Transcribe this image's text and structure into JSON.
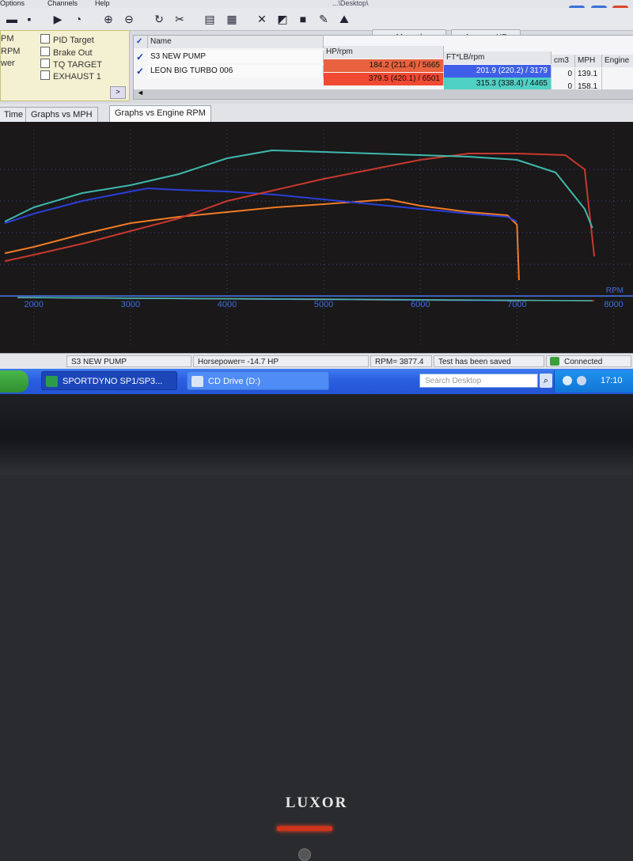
{
  "menu": {
    "items": [
      "Options",
      "Channels",
      "Help"
    ],
    "title_fragment": "...\\Desktop\\"
  },
  "toolbar": {
    "manual_label": "Manual",
    "average_hp_label": "Average HP"
  },
  "channels": [
    {
      "left_label": "PM",
      "right_label": "PID Target"
    },
    {
      "left_label": "RPM",
      "right_label": "Brake Out"
    },
    {
      "left_label": "wer",
      "right_label": "TQ TARGET"
    },
    {
      "left_label": "",
      "right_label": "EXHAUST 1"
    }
  ],
  "runs_table": {
    "columns": [
      "Name",
      "HP/rpm",
      "FT*LB/rpm",
      "cm3",
      "MPH",
      "Engine"
    ],
    "rows": [
      {
        "name": "S3 NEW PUMP",
        "hp": "184.2 (211.4) / 5665",
        "torque": "201.9 (220.2) / 3179",
        "cm3": "0",
        "mph": "139.1",
        "hp_color": "#e8623f",
        "tq_color": "#3f5fe8"
      },
      {
        "name": "LEON BIG TURBO 006",
        "hp": "379.5 (420.1) / 6501",
        "torque": "315.3 (338.4) / 4465",
        "cm3": "0",
        "mph": "158.1",
        "hp_color": "#f04a32",
        "tq_color": "#4fd0c4"
      }
    ]
  },
  "graph_tabs": [
    "Time",
    "Graphs vs MPH",
    "Graphs vs Engine RPM"
  ],
  "graph": {
    "x_axis_label": "RPM",
    "x_ticks": [
      "2000",
      "3000",
      "4000",
      "5000",
      "6000",
      "7000",
      "8000"
    ]
  },
  "chart_data": {
    "type": "line",
    "xlabel": "RPM",
    "xlim": [
      1650,
      8200
    ],
    "x_ticks": [
      2000,
      3000,
      4000,
      5000,
      6000,
      7000,
      8000
    ],
    "series": [
      {
        "name": "S3 NEW PUMP",
        "quantity": "HP",
        "color": "#f07b28",
        "x": [
          1700,
          2000,
          2500,
          3000,
          3500,
          4000,
          4500,
          5000,
          5665,
          6000,
          6500,
          6900,
          7000,
          7020
        ],
        "y": [
          0.27,
          0.31,
          0.39,
          0.46,
          0.5,
          0.53,
          0.56,
          0.58,
          0.61,
          0.57,
          0.53,
          0.51,
          0.45,
          0.1
        ]
      },
      {
        "name": "S3 NEW PUMP",
        "quantity": "TQ",
        "color": "#2b3fd6",
        "x": [
          1700,
          2000,
          2500,
          3000,
          3179,
          3500,
          4000,
          4500,
          5000,
          5500,
          6000,
          6500,
          6900,
          7000
        ],
        "y": [
          0.46,
          0.52,
          0.6,
          0.66,
          0.68,
          0.67,
          0.66,
          0.64,
          0.61,
          0.58,
          0.55,
          0.52,
          0.5,
          0.47
        ]
      },
      {
        "name": "LEON BIG TURBO 006",
        "quantity": "HP",
        "color": "#c8382e",
        "x": [
          1700,
          2000,
          2500,
          3000,
          3500,
          4000,
          4500,
          5000,
          5500,
          6000,
          6501,
          7000,
          7500,
          7700,
          7800
        ],
        "y": [
          0.22,
          0.26,
          0.33,
          0.41,
          0.49,
          0.6,
          0.67,
          0.74,
          0.8,
          0.86,
          0.9,
          0.9,
          0.89,
          0.8,
          0.25
        ]
      },
      {
        "name": "LEON BIG TURBO 006",
        "quantity": "TQ",
        "color": "#3fb8ae",
        "x": [
          1700,
          2000,
          2500,
          3000,
          3500,
          4000,
          4465,
          5000,
          5500,
          6000,
          6500,
          7000,
          7400,
          7700,
          7780
        ],
        "y": [
          0.47,
          0.56,
          0.65,
          0.7,
          0.77,
          0.87,
          0.92,
          0.91,
          0.9,
          0.89,
          0.88,
          0.86,
          0.78,
          0.55,
          0.43
        ]
      }
    ],
    "grid": true
  },
  "status": {
    "run_name": "S3 NEW PUMP",
    "horsepower": "Horsepower= -14.7 HP",
    "rpm": "RPM= 3877.4",
    "saved": "Test has been saved",
    "connected": "Connected"
  },
  "taskbar": {
    "tasks": [
      "SPORTDYNO SP1/SP3...",
      "CD Drive (D:)"
    ],
    "search_placeholder": "Search Desktop",
    "clock": "17:10"
  },
  "monitor": {
    "brand": "LUXOR"
  }
}
